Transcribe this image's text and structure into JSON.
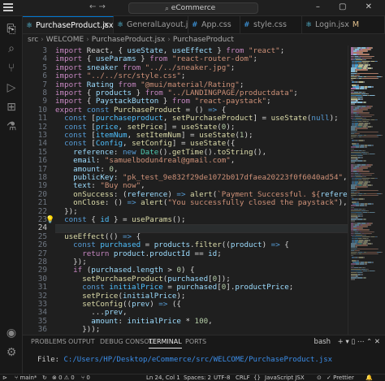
{
  "window": {
    "search_text": "eCommerce",
    "nav_arrows": "← →",
    "controls": "–  ▢  ✕"
  },
  "activity_bar": [
    {
      "name": "explorer-icon",
      "glyph": "⎘"
    },
    {
      "name": "search-icon",
      "glyph": "⌕"
    },
    {
      "name": "source-control-icon",
      "glyph": "⑂"
    },
    {
      "name": "run-debug-icon",
      "glyph": "▷"
    },
    {
      "name": "extensions-icon",
      "glyph": "⊞"
    },
    {
      "name": "testing-icon",
      "glyph": "⚗"
    },
    {
      "name": "account-icon",
      "glyph": "◉"
    },
    {
      "name": "settings-icon",
      "glyph": "⚙"
    }
  ],
  "tabs": [
    {
      "label": "PurchaseProduct.jsx",
      "badge": "M",
      "active": true,
      "icon": "⚛",
      "icon_color": "#61dafb"
    },
    {
      "label": "GeneralLayout.jsx",
      "badge": "",
      "active": false,
      "icon": "⚛",
      "icon_color": "#61dafb"
    },
    {
      "label": "App.css",
      "badge": "",
      "active": false,
      "icon": "#",
      "icon_color": "#42a5f5"
    },
    {
      "label": "style.css",
      "badge": "",
      "active": false,
      "icon": "#",
      "icon_color": "#42a5f5"
    },
    {
      "label": "Login.jsx",
      "badge": "M",
      "active": false,
      "icon": "⚛",
      "icon_color": "#61dafb"
    }
  ],
  "breadcrumb": [
    "src",
    "WELCOME",
    "PurchaseProduct.jsx",
    "PurchaseProduct"
  ],
  "editor": {
    "first_line_number": 3,
    "current_line": 24,
    "lines": [
      [
        [
          "kw",
          "import"
        ],
        [
          "pl",
          " React, { "
        ],
        [
          "vr",
          "useState"
        ],
        [
          "pl",
          ", "
        ],
        [
          "vr",
          "useEffect"
        ],
        [
          "pl",
          " } "
        ],
        [
          "kw",
          "from"
        ],
        [
          "st",
          " \"react\""
        ],
        [
          "pl",
          ";"
        ]
      ],
      [
        [
          "kw",
          "import"
        ],
        [
          "pl",
          " { "
        ],
        [
          "vr",
          "useParams"
        ],
        [
          "pl",
          " } "
        ],
        [
          "kw",
          "from"
        ],
        [
          "st",
          " \"react-router-dom\""
        ],
        [
          "pl",
          ";"
        ]
      ],
      [
        [
          "kw",
          "import"
        ],
        [
          "vr",
          " sneaker"
        ],
        [
          "kw",
          " from"
        ],
        [
          "st",
          " \"../../sneaker.jpg\""
        ],
        [
          "pl",
          ";"
        ]
      ],
      [
        [
          "kw",
          "import"
        ],
        [
          "st",
          " \"../../src/style.css\""
        ],
        [
          "pl",
          ";"
        ]
      ],
      [
        [
          "kw",
          "import"
        ],
        [
          "vr",
          " Rating"
        ],
        [
          "kw",
          " from"
        ],
        [
          "st",
          " \"@mui/material/Rating\""
        ],
        [
          "pl",
          ";"
        ]
      ],
      [
        [
          "kw",
          "import"
        ],
        [
          "pl",
          " { "
        ],
        [
          "vr",
          "products"
        ],
        [
          "pl",
          " } "
        ],
        [
          "kw",
          "from"
        ],
        [
          "st",
          " \"../LANDINGPAGE/productdata\""
        ],
        [
          "pl",
          ";"
        ]
      ],
      [
        [
          "kw",
          "import"
        ],
        [
          "pl",
          " { "
        ],
        [
          "vr",
          "PaystackButton"
        ],
        [
          "pl",
          " } "
        ],
        [
          "kw",
          "from"
        ],
        [
          "st",
          " \"react-paystack\""
        ],
        [
          "pl",
          ";"
        ]
      ],
      [
        [
          "kw",
          "export"
        ],
        [
          "bk",
          " const"
        ],
        [
          "fn",
          " PurchaseProduct"
        ],
        [
          "pl",
          " = () "
        ],
        [
          "bk",
          "=>"
        ],
        [
          "pl",
          " {"
        ]
      ],
      [
        [
          "pl",
          "  "
        ],
        [
          "bk",
          "const"
        ],
        [
          "pl",
          " ["
        ],
        [
          "cn",
          "purchaseproduct"
        ],
        [
          "pl",
          ", "
        ],
        [
          "fn",
          "setPurchaseProduct"
        ],
        [
          "pl",
          "] = "
        ],
        [
          "fn",
          "useState"
        ],
        [
          "pl",
          "("
        ],
        [
          "bk",
          "null"
        ],
        [
          "pl",
          ");"
        ]
      ],
      [
        [
          "pl",
          "  "
        ],
        [
          "bk",
          "const"
        ],
        [
          "pl",
          " ["
        ],
        [
          "cn",
          "price"
        ],
        [
          "pl",
          ", "
        ],
        [
          "fn",
          "setPrice"
        ],
        [
          "pl",
          "] = "
        ],
        [
          "fn",
          "useState"
        ],
        [
          "pl",
          "("
        ],
        [
          "nm",
          "0"
        ],
        [
          "pl",
          ");"
        ]
      ],
      [
        [
          "pl",
          "  "
        ],
        [
          "bk",
          "const"
        ],
        [
          "pl",
          " ["
        ],
        [
          "cn",
          "itemNum"
        ],
        [
          "pl",
          ", "
        ],
        [
          "fn",
          "setItemNum"
        ],
        [
          "pl",
          "] = "
        ],
        [
          "fn",
          "useState"
        ],
        [
          "pl",
          "("
        ],
        [
          "nm",
          "1"
        ],
        [
          "pl",
          ");"
        ]
      ],
      [
        [
          "pl",
          "  "
        ],
        [
          "bk",
          "const"
        ],
        [
          "pl",
          " ["
        ],
        [
          "cn",
          "Config"
        ],
        [
          "pl",
          ", "
        ],
        [
          "fn",
          "setConfig"
        ],
        [
          "pl",
          "] = "
        ],
        [
          "fn",
          "useState"
        ],
        [
          "pl",
          "({"
        ]
      ],
      [
        [
          "vr",
          "    reference"
        ],
        [
          "pl",
          ": "
        ],
        [
          "bk",
          "new"
        ],
        [
          "ty",
          " Date"
        ],
        [
          "pl",
          "()."
        ],
        [
          "fn",
          "getTime"
        ],
        [
          "pl",
          "()."
        ],
        [
          "fn",
          "toString"
        ],
        [
          "pl",
          "(),"
        ]
      ],
      [
        [
          "vr",
          "    email"
        ],
        [
          "pl",
          ": "
        ],
        [
          "st",
          "\"samuelbodun4real@gmail.com\""
        ],
        [
          "pl",
          ","
        ]
      ],
      [
        [
          "vr",
          "    amount"
        ],
        [
          "pl",
          ": "
        ],
        [
          "nm",
          "0"
        ],
        [
          "pl",
          ","
        ]
      ],
      [
        [
          "vr",
          "    publicKey"
        ],
        [
          "pl",
          ": "
        ],
        [
          "st",
          "\"pk_test_9e832f29de1072b017dfaea20223f0f6040ad54\""
        ],
        [
          "pl",
          ","
        ]
      ],
      [
        [
          "vr",
          "    text"
        ],
        [
          "pl",
          ": "
        ],
        [
          "st",
          "\"Buy now\""
        ],
        [
          "pl",
          ","
        ]
      ],
      [
        [
          "fn",
          "    onSuccess"
        ],
        [
          "pl",
          ": ("
        ],
        [
          "vr",
          "reference"
        ],
        [
          "pl",
          ") "
        ],
        [
          "bk",
          "=>"
        ],
        [
          "fn",
          " alert"
        ],
        [
          "pl",
          "("
        ],
        [
          "st",
          "`Payment Successful. ${"
        ],
        [
          "vr",
          "reference"
        ],
        [
          "st",
          "}`"
        ],
        [
          "pl",
          "),"
        ]
      ],
      [
        [
          "fn",
          "    onClose"
        ],
        [
          "pl",
          ": () "
        ],
        [
          "bk",
          "=>"
        ],
        [
          "fn",
          " alert"
        ],
        [
          "pl",
          "("
        ],
        [
          "st",
          "\"You successfully closed the paystack\""
        ],
        [
          "pl",
          "),"
        ]
      ],
      [
        [
          "pl",
          "  });"
        ]
      ],
      [
        [
          "pl",
          "  "
        ],
        [
          "bk",
          "const"
        ],
        [
          "pl",
          " { "
        ],
        [
          "cn",
          "id"
        ],
        [
          "pl",
          " } = "
        ],
        [
          "fn",
          "useParams"
        ],
        [
          "pl",
          "();"
        ]
      ],
      [
        [
          "pl",
          ""
        ]
      ],
      [
        [
          "pl",
          "  "
        ],
        [
          "fn",
          "useEffect"
        ],
        [
          "pl",
          "(() "
        ],
        [
          "bk",
          "=>"
        ],
        [
          "pl",
          " {"
        ]
      ],
      [
        [
          "pl",
          "    "
        ],
        [
          "bk",
          "const"
        ],
        [
          "cn",
          " purchased"
        ],
        [
          "pl",
          " = "
        ],
        [
          "vr",
          "products"
        ],
        [
          "pl",
          "."
        ],
        [
          "fn",
          "filter"
        ],
        [
          "pl",
          "(("
        ],
        [
          "vr",
          "product"
        ],
        [
          "pl",
          ") "
        ],
        [
          "bk",
          "=>"
        ],
        [
          "pl",
          " {"
        ]
      ],
      [
        [
          "kw",
          "      return"
        ],
        [
          "vr",
          " product"
        ],
        [
          "pl",
          "."
        ],
        [
          "vr",
          "productId"
        ],
        [
          "pl",
          " == "
        ],
        [
          "vr",
          "id"
        ],
        [
          "pl",
          ";"
        ]
      ],
      [
        [
          "pl",
          "    });"
        ]
      ],
      [
        [
          "kw",
          "    if"
        ],
        [
          "pl",
          " ("
        ],
        [
          "vr",
          "purchased"
        ],
        [
          "pl",
          "."
        ],
        [
          "vr",
          "length"
        ],
        [
          "pl",
          " > "
        ],
        [
          "nm",
          "0"
        ],
        [
          "pl",
          ") {"
        ]
      ],
      [
        [
          "fn",
          "      setPurchaseProduct"
        ],
        [
          "pl",
          "("
        ],
        [
          "vr",
          "purchased"
        ],
        [
          "pl",
          "["
        ],
        [
          "nm",
          "0"
        ],
        [
          "pl",
          "]);"
        ]
      ],
      [
        [
          "bk",
          "      const"
        ],
        [
          "cn",
          " initialPrice"
        ],
        [
          "pl",
          " = "
        ],
        [
          "vr",
          "purchased"
        ],
        [
          "pl",
          "["
        ],
        [
          "nm",
          "0"
        ],
        [
          "pl",
          "]."
        ],
        [
          "vr",
          "productPrice"
        ],
        [
          "pl",
          ";"
        ]
      ],
      [
        [
          "fn",
          "      setPrice"
        ],
        [
          "pl",
          "("
        ],
        [
          "vr",
          "initialPrice"
        ],
        [
          "pl",
          ");"
        ]
      ],
      [
        [
          "fn",
          "      setConfig"
        ],
        [
          "pl",
          "(("
        ],
        [
          "vr",
          "prev"
        ],
        [
          "pl",
          ") "
        ],
        [
          "bk",
          "=>"
        ],
        [
          "pl",
          " ({"
        ]
      ],
      [
        [
          "pl",
          "        ..."
        ],
        [
          "vr",
          "prev"
        ],
        [
          "pl",
          ","
        ]
      ],
      [
        [
          "vr",
          "        amount"
        ],
        [
          "pl",
          ": "
        ],
        [
          "vr",
          "initialPrice"
        ],
        [
          "pl",
          " * "
        ],
        [
          "nm",
          "100"
        ],
        [
          "pl",
          ","
        ]
      ],
      [
        [
          "pl",
          "      }));"
        ]
      ]
    ]
  },
  "panel": {
    "tabs": [
      "PROBLEMS",
      "OUTPUT",
      "DEBUG CONSOLE",
      "TERMINAL",
      "PORTS"
    ],
    "active_tab": "TERMINAL",
    "terminal_shell": "bash",
    "terminal_actions": "+ ▾ ▯ ⋯ ⌃ ✕",
    "terminal_label": "File: ",
    "terminal_path": "C:/Users/HP/Desktop/eCommerce/src/WELCOME/PurchaseProduct.jsx"
  },
  "status_bar": {
    "branch": "main*",
    "sync": "↻",
    "problems": "⊗ 0 ⚠ 0",
    "ports": "⑂ 0",
    "cursor": "Ln 24, Col 1",
    "spaces": "Spaces: 2",
    "encoding": "UTF-8",
    "eol": "CRLF",
    "braces": "{}",
    "language": "JavaScript JSX",
    "golive": "⊙",
    "prettier": "✓ Prettier",
    "bell": "🔔"
  },
  "colors": {
    "accent": "#0078d4",
    "editor_bg": "#1f1f1f",
    "modified_badge": "#e2c08d"
  }
}
